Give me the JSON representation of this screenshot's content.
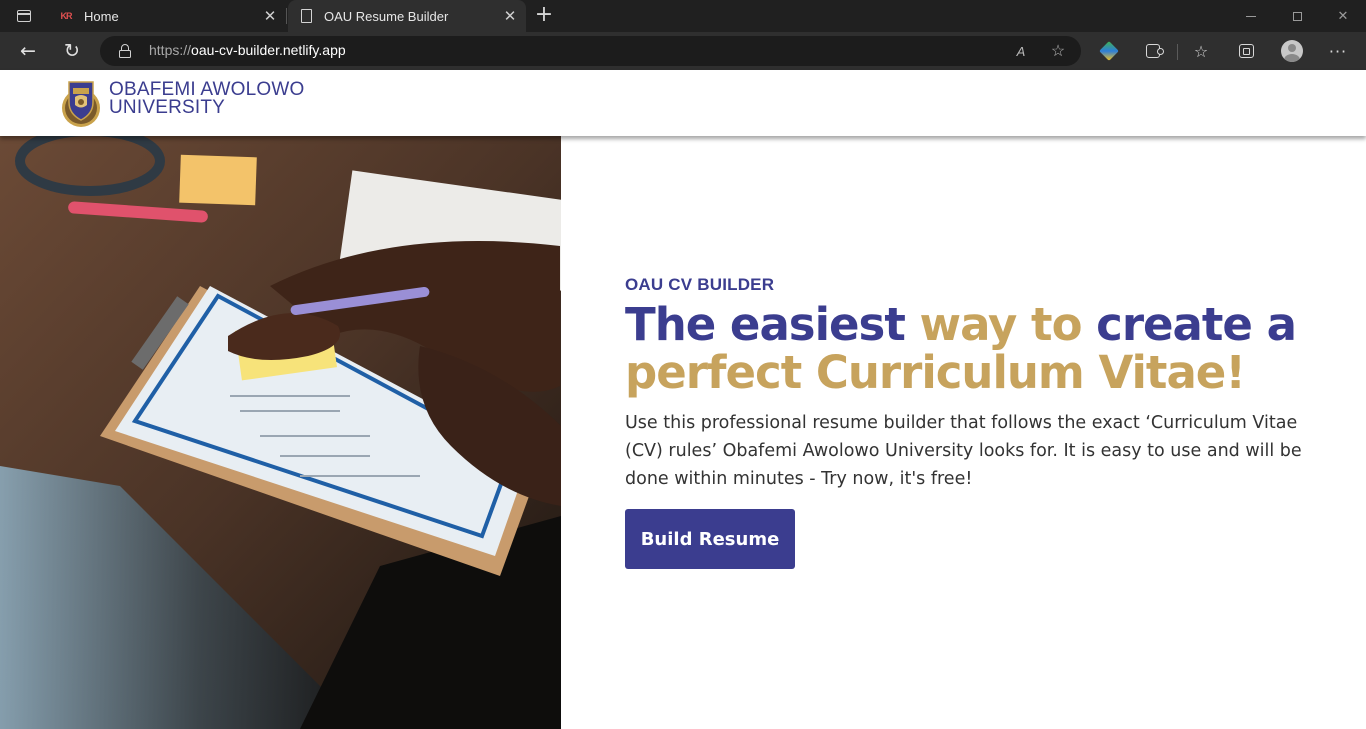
{
  "browser": {
    "tabs": [
      {
        "title": "Home",
        "favicon": "kr-logo-icon"
      },
      {
        "title": "OAU Resume Builder",
        "favicon": "page-icon"
      }
    ],
    "close_glyph": "✕",
    "new_tab_glyph": "+",
    "address": {
      "scheme": "https://",
      "host": "oau-cv-builder.netlify.app"
    },
    "read_aloud_glyph": "A",
    "favorite_glyph": "☆",
    "favorites_glyph": "☆",
    "back_glyph": "←",
    "reload_glyph": "↻",
    "more_glyph": "···",
    "window_close_glyph": "✕",
    "colors": {
      "tabbar": "#202020",
      "toolbar": "#2f2f2f",
      "address_bg": "#1c1c1c"
    }
  },
  "site": {
    "brand": {
      "line1": "OBAFEMI AWOLOWO",
      "line2": "UNIVERSITY"
    },
    "colors": {
      "brand_blue": "#3b3d8f",
      "brand_gold": "#c7a35d"
    }
  },
  "hero": {
    "eyebrow": "OAU CV BUILDER",
    "headline": {
      "part1": "The easiest ",
      "part2": "way to",
      "part3": " create a",
      "part4": "perfect Curriculum Vitae!"
    },
    "description": "Use this professional resume builder that follows the exact ‘Curriculum Vitae (CV) rules’ Obafemi Awolowo University looks for. It is easy to use and will be done within minutes - Try now, it's free!",
    "cta_label": "Build Resume"
  }
}
